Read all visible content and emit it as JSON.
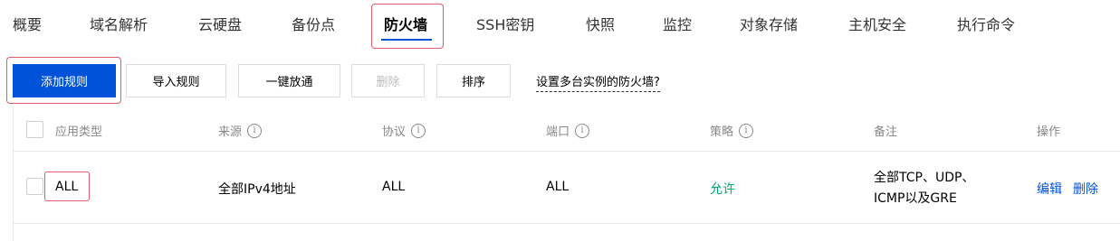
{
  "tabs": [
    {
      "label": "概要"
    },
    {
      "label": "域名解析"
    },
    {
      "label": "云硬盘"
    },
    {
      "label": "备份点"
    },
    {
      "label": "防火墙",
      "active": true
    },
    {
      "label": "SSH密钥"
    },
    {
      "label": "快照"
    },
    {
      "label": "监控"
    },
    {
      "label": "对象存储"
    },
    {
      "label": "主机安全"
    },
    {
      "label": "执行命令"
    }
  ],
  "toolbar": {
    "add_rule": "添加规则",
    "import_rules": "导入规则",
    "allow_all": "一键放通",
    "delete": "删除",
    "sort": "排序",
    "help_link": "设置多台实例的防火墙?"
  },
  "table": {
    "headers": {
      "app_type": "应用类型",
      "source": "来源",
      "protocol": "协议",
      "port": "端口",
      "policy": "策略",
      "remark": "备注",
      "actions": "操作"
    },
    "info_glyph": "i",
    "rows": [
      {
        "app_type": "ALL",
        "source": "全部IPv4地址",
        "protocol": "ALL",
        "port": "ALL",
        "policy": "允许",
        "remark_line1": "全部TCP、UDP、",
        "remark_line2": "ICMP以及GRE",
        "edit": "编辑",
        "delete": "删除"
      }
    ]
  },
  "colors": {
    "accent": "#0052d9",
    "allow": "#00a870",
    "highlight": "#e45b6c"
  }
}
